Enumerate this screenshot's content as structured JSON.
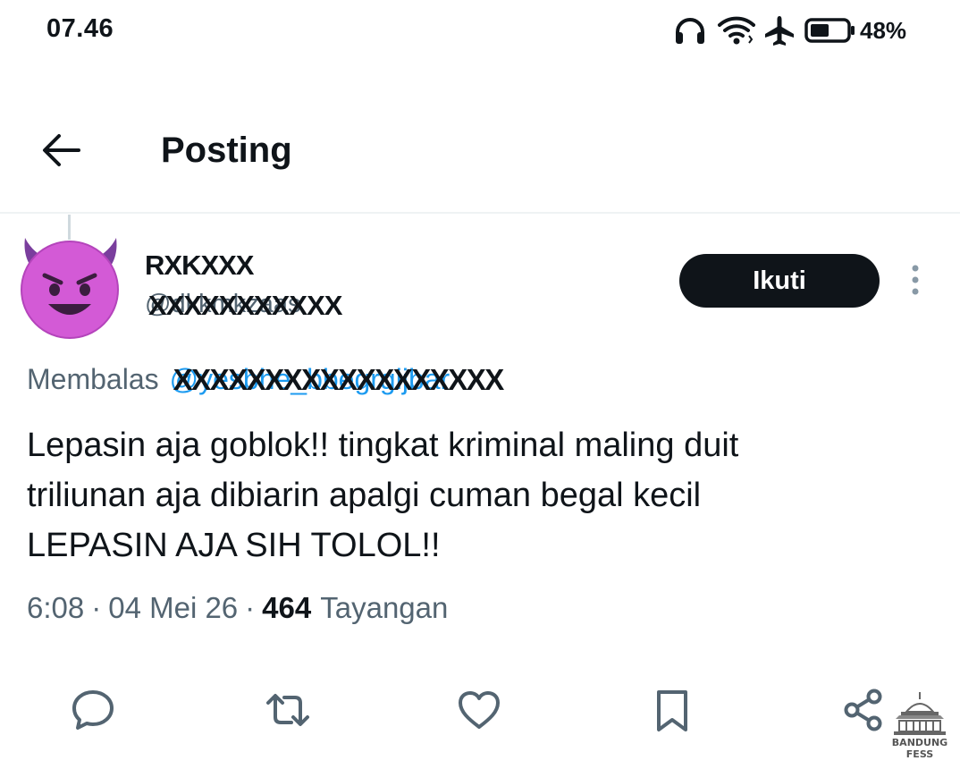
{
  "status_bar": {
    "time": "07.46",
    "battery_percent": "48%",
    "icons": [
      "headphones-icon",
      "wifi-icon",
      "airplane-icon",
      "battery-icon"
    ]
  },
  "header": {
    "title": "Posting"
  },
  "post": {
    "display_name": "RXKXXX",
    "handle": "@dkkmkzaas",
    "handle_redacted": "XXXXXXXXXXX",
    "follow_label": "Ikuti",
    "replying_label": "Membalas",
    "replying_handle": "@yesbhe_bbegrgijbar",
    "replying_handle_redacted": "XXXXXXXXXXXXXXXXXX",
    "text": "Lepasin aja goblok!! tingkat kriminal maling duit\ntriliunan aja dibiarin apalgi cuman begal kecil\nLEPASIN AJA SIH TOLOL!!",
    "time": "6:08",
    "date": "04 Mei 26",
    "separator": "·",
    "views_count": "464",
    "views_label": "Tayangan"
  },
  "actions": [
    "reply-icon",
    "repost-icon",
    "like-icon",
    "bookmark-icon",
    "share-icon"
  ],
  "watermark": {
    "line1": "BANDUNG",
    "line2": "FESS"
  },
  "colors": {
    "text_primary": "#0f1419",
    "text_secondary": "#536471",
    "link": "#1d9bf0",
    "follow_bg": "#0f1419",
    "divider": "#eff3f4",
    "avatar_purple": "#d35ad6"
  }
}
